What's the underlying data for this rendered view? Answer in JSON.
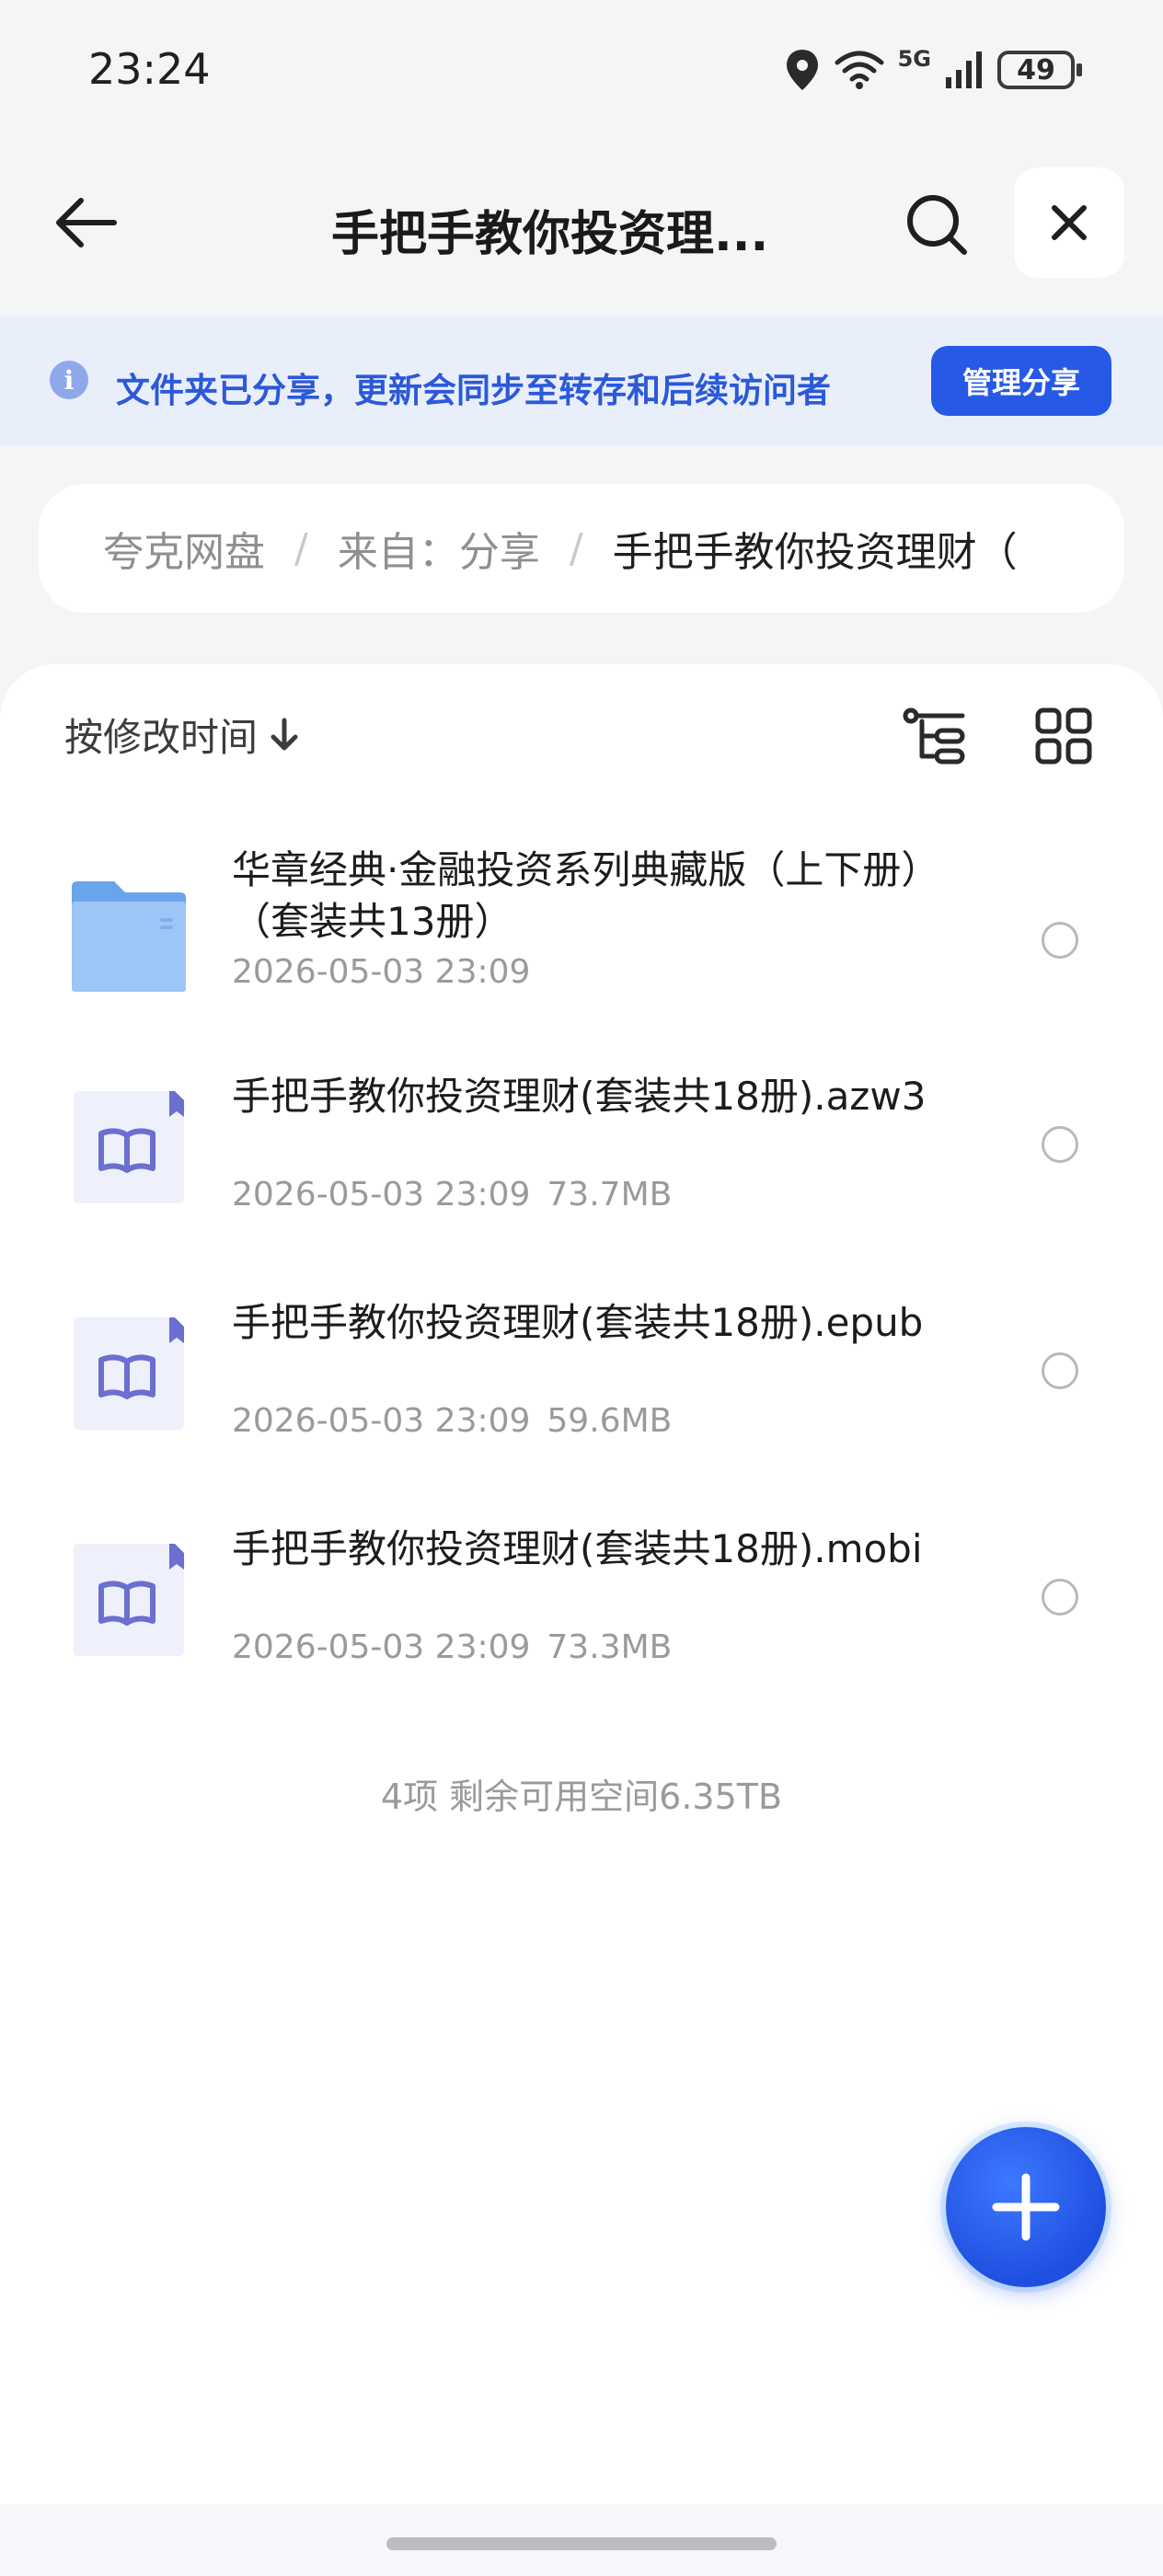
{
  "status_bar": {
    "time": "23:24",
    "network_label": "5G",
    "battery_level": "49",
    "icons": [
      "location-icon",
      "wifi-icon",
      "signal-icon",
      "battery-icon"
    ]
  },
  "header": {
    "title": "手把手教你投资理...",
    "icons": [
      "back-arrow-icon",
      "search-icon",
      "close-icon"
    ]
  },
  "banner": {
    "text": "文件夹已分享，更新会同步至转存和后续访问者",
    "button_label": "管理分享",
    "icon": "info-icon"
  },
  "breadcrumb": {
    "items": [
      "夸克网盘",
      "来自：分享",
      "手把手教你投资理财（"
    ],
    "separator": "/"
  },
  "toolbar": {
    "sort_label": "按修改时间",
    "icons": [
      "sort-down-arrow-icon",
      "tree-view-icon",
      "grid-view-icon"
    ]
  },
  "files": [
    {
      "name": "华章经典·金融投资系列典藏版（上下册）（套装共13册）",
      "date": "2026-05-03 23:09",
      "size": "",
      "type": "folder"
    },
    {
      "name": "手把手教你投资理财(套装共18册).azw3",
      "date": "2026-05-03 23:09",
      "size": "73.7MB",
      "type": "ebook"
    },
    {
      "name": "手把手教你投资理财(套装共18册).epub",
      "date": "2026-05-03 23:09",
      "size": "59.6MB",
      "type": "ebook"
    },
    {
      "name": "手把手教你投资理财(套装共18册).mobi",
      "date": "2026-05-03 23:09",
      "size": "73.3MB",
      "type": "ebook"
    }
  ],
  "footer": {
    "summary": "4项 剩余可用空间6.35TB"
  },
  "colors": {
    "accent": "#2659e6",
    "banner_bg": "#e9eefb",
    "folder": "#7fb3f0",
    "ebook_icon": "#6a6fd0"
  }
}
